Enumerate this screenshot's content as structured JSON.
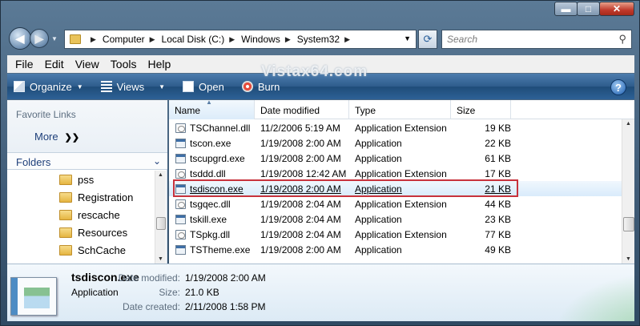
{
  "window": {
    "minimize_label": "▬",
    "maximize_label": "□",
    "close_label": "✕"
  },
  "nav": {
    "back_label": "◀",
    "forward_label": "▶"
  },
  "address": {
    "crumbs": [
      "Computer",
      "Local Disk (C:)",
      "Windows",
      "System32"
    ]
  },
  "search": {
    "placeholder": "Search"
  },
  "menu": {
    "file": "File",
    "edit": "Edit",
    "view": "View",
    "tools": "Tools",
    "help": "Help"
  },
  "toolbar": {
    "organize": "Organize",
    "views": "Views",
    "open": "Open",
    "burn": "Burn",
    "help": "?"
  },
  "watermark": "Vistax64.com",
  "left": {
    "favorite_links": "Favorite Links",
    "more": "More",
    "folders": "Folders",
    "tree": [
      "pss",
      "Registration",
      "rescache",
      "Resources",
      "SchCache"
    ]
  },
  "columns": {
    "name": "Name",
    "date": "Date modified",
    "type": "Type",
    "size": "Size"
  },
  "files": [
    {
      "name": "TSChannel.dll",
      "date": "11/2/2006 5:19 AM",
      "type": "Application Extension",
      "size": "19 KB",
      "icon": "dll"
    },
    {
      "name": "tscon.exe",
      "date": "1/19/2008 2:00 AM",
      "type": "Application",
      "size": "22 KB",
      "icon": "exe"
    },
    {
      "name": "tscupgrd.exe",
      "date": "1/19/2008 2:00 AM",
      "type": "Application",
      "size": "61 KB",
      "icon": "exe"
    },
    {
      "name": "tsddd.dll",
      "date": "1/19/2008 12:42 AM",
      "type": "Application Extension",
      "size": "17 KB",
      "icon": "dll"
    },
    {
      "name": "tsdiscon.exe",
      "date": "1/19/2008 2:00 AM",
      "type": "Application",
      "size": "21 KB",
      "icon": "exe"
    },
    {
      "name": "tsgqec.dll",
      "date": "1/19/2008 2:04 AM",
      "type": "Application Extension",
      "size": "44 KB",
      "icon": "dll"
    },
    {
      "name": "tskill.exe",
      "date": "1/19/2008 2:04 AM",
      "type": "Application",
      "size": "23 KB",
      "icon": "exe"
    },
    {
      "name": "TSpkg.dll",
      "date": "1/19/2008 2:04 AM",
      "type": "Application Extension",
      "size": "77 KB",
      "icon": "dll"
    },
    {
      "name": "TSTheme.exe",
      "date": "1/19/2008 2:00 AM",
      "type": "Application",
      "size": "49 KB",
      "icon": "exe"
    }
  ],
  "selected_index": 4,
  "details": {
    "name": "tsdiscon.exe",
    "type": "Application",
    "date_modified_label": "Date modified:",
    "date_modified": "1/19/2008 2:00 AM",
    "size_label": "Size:",
    "size": "21.0 KB",
    "date_created_label": "Date created:",
    "date_created": "2/11/2008 1:58 PM"
  },
  "colors": {
    "selection_outline": "#c8323c",
    "toolbar": "#2e5c8c"
  }
}
